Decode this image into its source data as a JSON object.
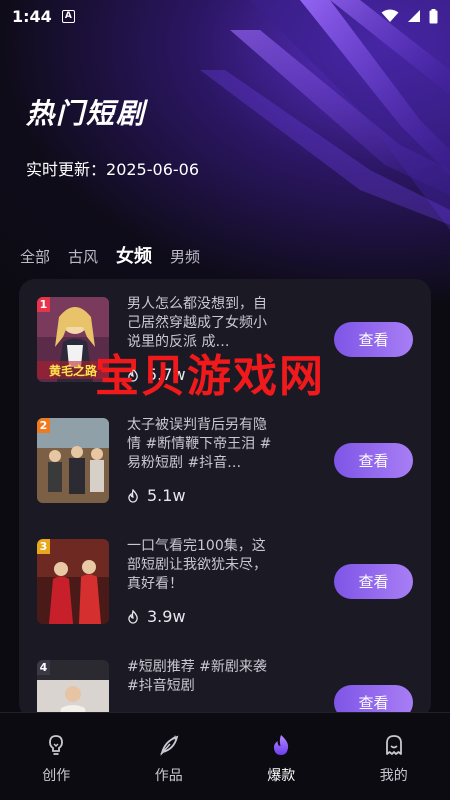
{
  "status": {
    "time": "1:44",
    "a_badge": "A"
  },
  "header": {
    "title": "热门短剧",
    "update_label": "实时更新：",
    "update_date": "2025-06-06"
  },
  "tabs": [
    {
      "label": "全部",
      "active": false
    },
    {
      "label": "古风",
      "active": false
    },
    {
      "label": "女频",
      "active": true
    },
    {
      "label": "男频",
      "active": false
    }
  ],
  "items": [
    {
      "rank": "1",
      "rank_color": "#e8344a",
      "thumb_text": "黄毛之路",
      "desc": "男人怎么都没想到，自己居然穿越成了女频小说里的反派 成…",
      "views": "5.7w",
      "button": "查看"
    },
    {
      "rank": "2",
      "rank_color": "#f07a1f",
      "desc": "太子被误判背后另有隐情 #断情鞭下帝王泪 #易粉短剧 #抖音…",
      "views": "5.1w",
      "button": "查看"
    },
    {
      "rank": "3",
      "rank_color": "#e8a81c",
      "desc": "一口气看完100集，这部短剧让我欲犹未尽，真好看！",
      "views": "3.9w",
      "button": "查看"
    },
    {
      "rank": "4",
      "rank_color": "#3a3945",
      "desc": "#短剧推荐 #新剧来袭 #抖音短剧",
      "views": "",
      "button": "查看"
    }
  ],
  "watermark": "宝贝游戏网",
  "tabbar": [
    {
      "label": "创作",
      "icon": "bulb-icon",
      "active": false
    },
    {
      "label": "作品",
      "icon": "feather-icon",
      "active": false
    },
    {
      "label": "爆款",
      "icon": "flame-icon",
      "active": true
    },
    {
      "label": "我的",
      "icon": "ghost-icon",
      "active": false
    }
  ],
  "colors": {
    "accent": "#8b5cf6",
    "watermark": "#f0191c",
    "card_bg": "#1b1a24"
  }
}
